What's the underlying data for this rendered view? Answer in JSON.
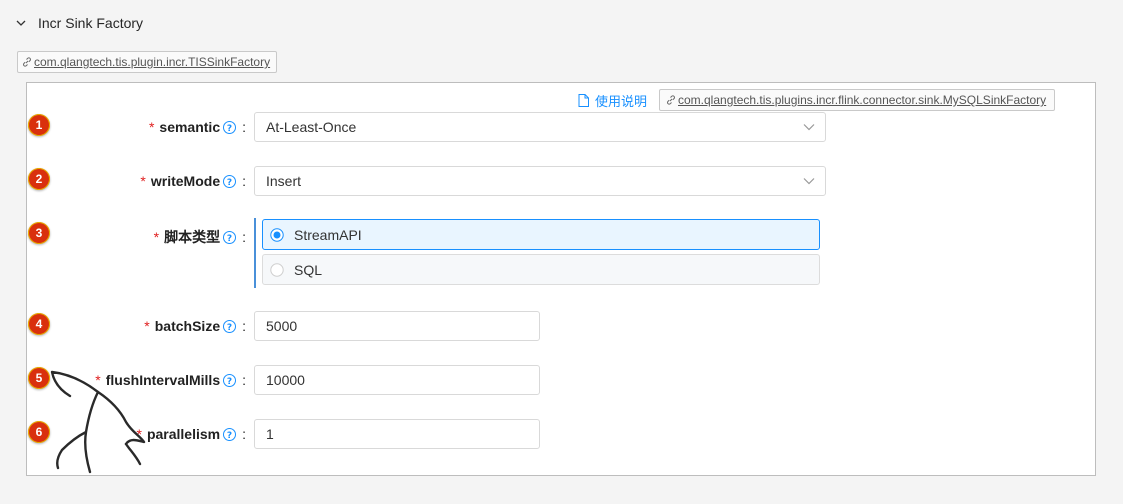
{
  "header": {
    "title": "Incr Sink Factory"
  },
  "outer_plugin": {
    "name": "com.qlangtech.tis.plugin.incr.TISSinkFactory"
  },
  "panel": {
    "doc_link": "使用说明",
    "plugin": "com.qlangtech.tis.plugins.incr.flink.connector.sink.MySQLSinkFactory"
  },
  "fields": {
    "semantic": {
      "badge": "1",
      "label": "semantic",
      "value": "At-Least-Once"
    },
    "writeMode": {
      "badge": "2",
      "label": "writeMode",
      "value": "Insert"
    },
    "script_type": {
      "badge": "3",
      "label": "脚本类型",
      "options": [
        {
          "label": "StreamAPI",
          "checked": true
        },
        {
          "label": "SQL",
          "checked": false
        }
      ]
    },
    "batchSize": {
      "badge": "4",
      "label": "batchSize",
      "value": "5000"
    },
    "flushIntervalMills": {
      "badge": "5",
      "label": "flushIntervalMills",
      "value": "10000"
    },
    "parallelism": {
      "badge": "6",
      "label": "parallelism",
      "value": "1"
    }
  },
  "common": {
    "required_mark": "*",
    "colon": ":"
  },
  "colors": {
    "accent": "#1890ff",
    "required": "#e02020",
    "badge": "#d9300d"
  },
  "icons": [
    "chevron-down-icon",
    "link-icon",
    "document-icon",
    "help-icon",
    "select-arrow-icon",
    "radio-icon"
  ]
}
